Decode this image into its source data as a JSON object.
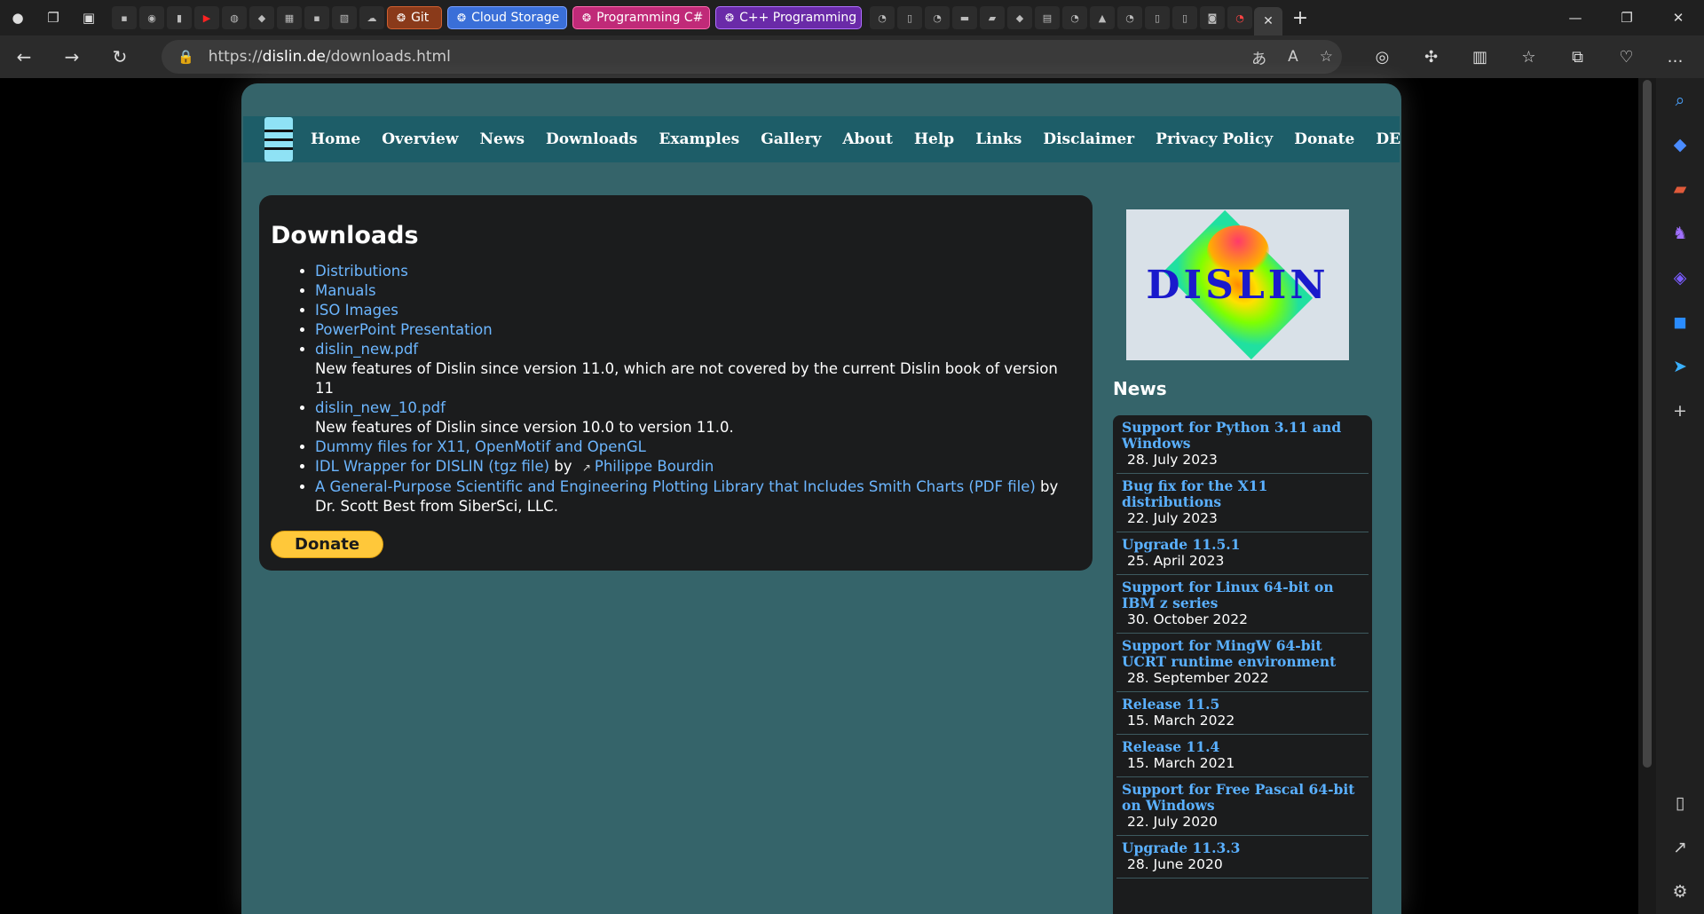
{
  "browser": {
    "tabs": {
      "git": "Git",
      "cloud": "Cloud Storage",
      "prog_csharp": "Programming C#",
      "cpp": "C++ Programming"
    },
    "url_prefix": "https://",
    "url_host": "dislin.de",
    "url_path": "/downloads.html"
  },
  "nav": [
    "Home",
    "Overview",
    "News",
    "Downloads",
    "Examples",
    "Gallery",
    "About",
    "Help",
    "Links",
    "Disclaimer",
    "Privacy Policy",
    "Donate",
    "DE"
  ],
  "main": {
    "heading": "Downloads",
    "items": [
      {
        "link": "Distributions",
        "text": ""
      },
      {
        "link": "Manuals",
        "text": ""
      },
      {
        "link": "ISO Images",
        "text": ""
      },
      {
        "link": "PowerPoint Presentation",
        "text": ""
      },
      {
        "link": "dislin_new.pdf",
        "text": "New features of Dislin since version 11.0, which are not covered by the current Dislin book of version 11"
      },
      {
        "link": "dislin_new_10.pdf",
        "text": "New features of Dislin since version 10.0 to version 11.0."
      },
      {
        "link": "Dummy files for X11, OpenMotif and OpenGL",
        "text": ""
      },
      {
        "link": "IDL Wrapper for DISLIN (tgz file)",
        "by": " by ",
        "link2": "Philippe Bourdin"
      },
      {
        "link": "A General-Purpose Scientific and Engineering Plotting Library that Includes Smith Charts (PDF file)",
        "by2": " by Dr. Scott Best from SiberSci, LLC."
      }
    ],
    "donate": "Donate"
  },
  "logo_text": "DISLIN",
  "news": {
    "heading": "News",
    "items": [
      {
        "title": "Support for Python 3.11 and Windows",
        "date": "28. July 2023"
      },
      {
        "title": "Bug fix for the X11 distributions",
        "date": "22. July 2023"
      },
      {
        "title": "Upgrade 11.5.1",
        "date": "25. April 2023"
      },
      {
        "title": "Support for Linux 64-bit on IBM z series",
        "date": "30. October 2022"
      },
      {
        "title": "Support for MingW 64-bit UCRT runtime environment",
        "date": "28. September 2022"
      },
      {
        "title": "Release 11.5",
        "date": "15. March 2022"
      },
      {
        "title": "Release 11.4",
        "date": "15. March 2021"
      },
      {
        "title": "Support for Free Pascal 64-bit on Windows",
        "date": "22. July 2020"
      },
      {
        "title": "Upgrade 11.3.3",
        "date": "28. June 2020"
      }
    ]
  }
}
